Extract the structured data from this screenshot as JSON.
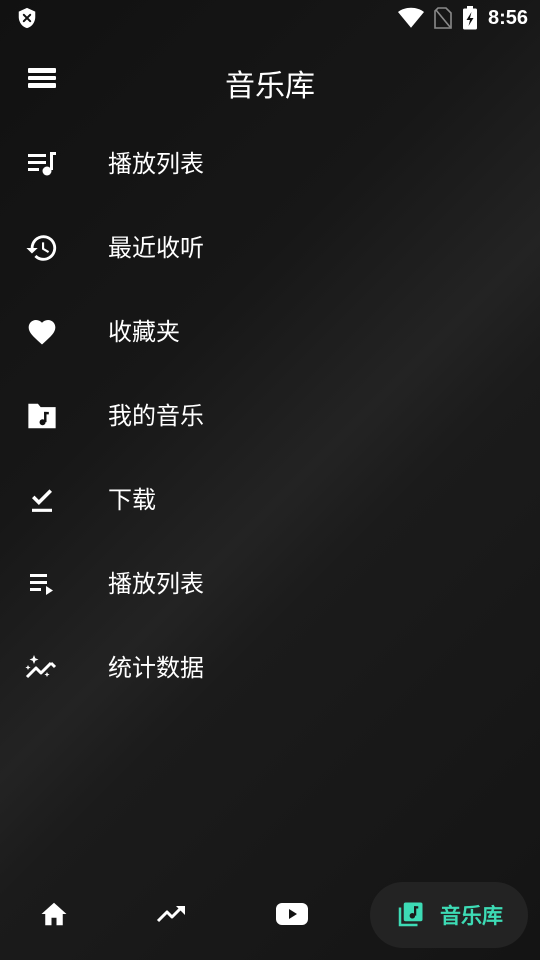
{
  "status_bar": {
    "time": "8:56",
    "left_icon": "shield-x-icon",
    "icons": [
      "wifi-icon",
      "no-sim-icon",
      "battery-charging-icon"
    ]
  },
  "header": {
    "title": "音乐库",
    "menu_icon": "stack-menu-icon"
  },
  "menu": {
    "items": [
      {
        "icon": "playlist-music-icon",
        "label": "播放列表"
      },
      {
        "icon": "history-icon",
        "label": "最近收听"
      },
      {
        "icon": "heart-icon",
        "label": "收藏夹"
      },
      {
        "icon": "folder-music-icon",
        "label": "我的音乐"
      },
      {
        "icon": "download-done-icon",
        "label": "下载"
      },
      {
        "icon": "playlist-play-icon",
        "label": "播放列表"
      },
      {
        "icon": "stats-sparkle-icon",
        "label": "统计数据"
      }
    ]
  },
  "bottom_nav": {
    "items": [
      {
        "icon": "home-icon"
      },
      {
        "icon": "trending-icon"
      },
      {
        "icon": "youtube-icon"
      },
      {
        "icon": "library-music-icon",
        "label": "音乐库",
        "active": true
      }
    ]
  },
  "colors": {
    "accent": "#3ddbb5",
    "text": "#ffffff",
    "active_pill": "#232323"
  }
}
